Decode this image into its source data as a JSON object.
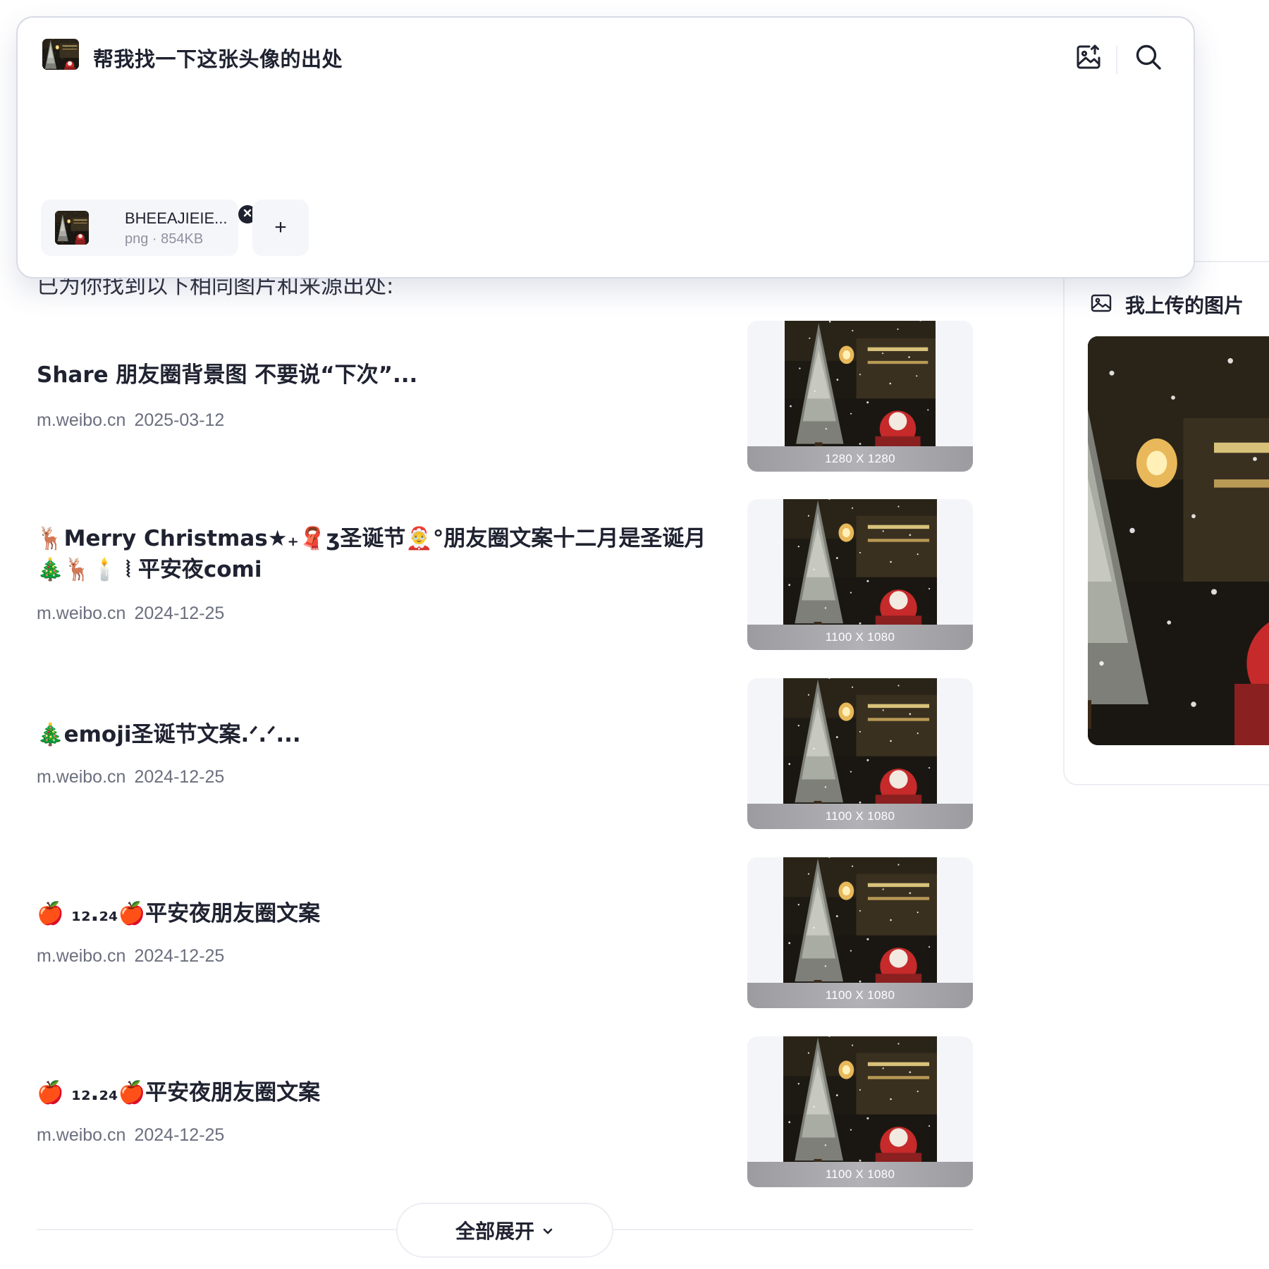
{
  "query": {
    "text": "帮我找一下这张头像的出处",
    "upload_icon": "image-upload-icon",
    "search_icon": "search-icon"
  },
  "attachment": {
    "name": "BHEEAJIEIE...",
    "meta": "png · 854KB",
    "remove_icon": "close-circle-icon",
    "add_label": "+"
  },
  "results": {
    "intro": "已为你找到以下相同图片和来源出处:",
    "items": [
      {
        "title": "Share 朋友圈背景图 不要说“下次”...",
        "source": "m.weibo.cn",
        "date": "2025-03-12",
        "dims": "1280 X 1280"
      },
      {
        "title": "🦌Merry Christmas★₊🧣ʒ圣诞节🤶°朋友圈文案十二月是圣诞月🎄🦌🕯️ ⦚ 平安夜comi",
        "source": "m.weibo.cn",
        "date": "2024-12-25",
        "dims": "1100 X 1080"
      },
      {
        "title": "🎄emoji圣诞节文案.ᐟ.ᐟ...",
        "source": "m.weibo.cn",
        "date": "2024-12-25",
        "dims": "1100 X 1080"
      },
      {
        "title": "🍎 ₁₂.₂₄🍎平安夜朋友圈文案",
        "source": "m.weibo.cn",
        "date": "2024-12-25",
        "dims": "1100 X 1080"
      },
      {
        "title": "🍎 ₁₂.₂₄🍎平安夜朋友圈文案",
        "source": "m.weibo.cn",
        "date": "2024-12-25",
        "dims": "1100 X 1080"
      }
    ],
    "expand_label": "全部展开",
    "expand_icon": "chevron-down-icon"
  },
  "panel": {
    "title": "我上传的图片",
    "title_icon": "image-icon"
  },
  "colors": {
    "text": "#1f2230",
    "muted": "#6b6f7e",
    "border": "#d9dbe6",
    "chip_bg": "#f5f6f9"
  }
}
